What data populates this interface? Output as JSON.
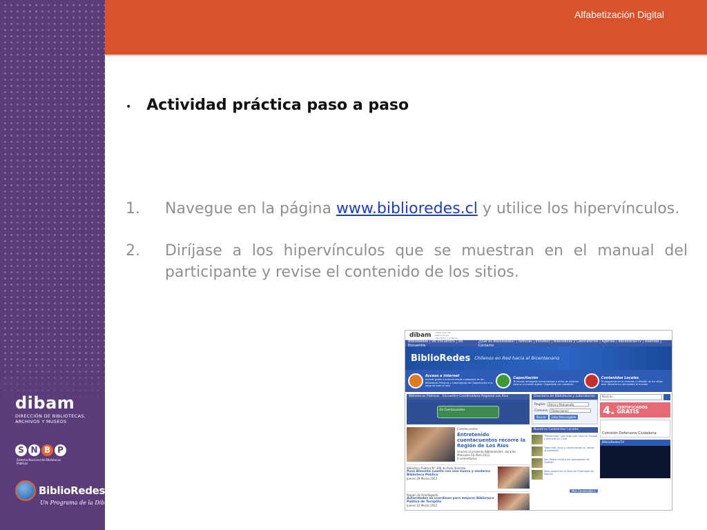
{
  "header": {
    "title": "Alfabetización Digital",
    "color": "#d9522a"
  },
  "sidebar": {
    "color": "#5b3c7a",
    "logos": {
      "dibam_word": "dibam",
      "dibam_sub_1": "DIRECCIÓN DE BIBLIOTECAS,",
      "dibam_sub_2": "ARCHIVOS Y MUSEOS",
      "snbp_letters": [
        "S",
        "N",
        "B",
        "P"
      ],
      "snbp_sub": "Sistema Nacional de Bibliotecas Públicas",
      "biblioredes_name": "BiblioRedes",
      "biblioredes_tag": "Un Programa de la Dibam"
    }
  },
  "content": {
    "bullet": "•",
    "heading": "Actividad práctica paso a paso",
    "steps": [
      {
        "number": "1.",
        "text_before": "Navegue en la página",
        "link": "www.biblioredes.cl",
        "text_after": "y utilice los hipervínculos."
      },
      {
        "number": "2.",
        "text": "Diríjase a los hipervínculos que se muestran en el manual del participante y revise el contenido de los sitios."
      }
    ]
  },
  "website": {
    "top_brand": "dibam",
    "top_sub": "DIRECCIÓN DE BIBLIOTECAS, ARCHIVOS Y MUSEOS",
    "nav_left": "BiblioRedes | VB Encuentro | VB Encuentro",
    "nav_right": "¿Qué es BiblioRedes? | Noticias | Estudios | Bibliotecas y Laboratorios | Agenda | BibliotecasTV | Alianzas | Contacto",
    "brand": "BiblioRedes",
    "slogan": "Chilenos en Red hacia el Bicentenario",
    "services": [
      {
        "title": "Acceso a Internet",
        "desc": "Accede gratis a internet desde cualquiera de las Bibliotecas Públicas y Laboratorios de Capacitación a lo largo de todo el país."
      },
      {
        "title": "Capacitación",
        "desc": "Te hemos entregado herramientas a miles de chilenos para su inclusión digital. Capacítate con nosotros."
      },
      {
        "title": "Contenidos Locales",
        "desc": "Te apoyamos en la creación y difusión de tus sitios web. Muestra tu comunidad al mundo!"
      }
    ],
    "radio_label": "Bibliotecas Públicas",
    "radio_station": "Encuentro Coordinadora Regional Los Ríos",
    "player_text": "En Cuentacuentos",
    "news_kicker": "Cuentacuentos",
    "news_title": "Entretenido cuentacuentos recorre la Región de Los Ríos",
    "news_desc": "Gracias al proyecto Bibliomóviles, durante",
    "news_date": "Miércoles 04 Abril 2012",
    "news_comments": "0 comentarios",
    "news2_kicker": "Biblioteca Pública N° 306 de Pozo Almonte",
    "news2_title": "Pozo Almonte cuenta con una nueva y moderno Biblioteca Pública",
    "news2_date": "Jueves 29 Marzo 2012",
    "news3_kicker": "Región de Antofagasta",
    "news3_title": "Autoridades se coordinan para mejorar Biblioteca Pública de Tocopilla",
    "news3_date": "Jueves 22 Marzo 2012",
    "directory_head": "Directorio de Bibliotecas y Laboratorios",
    "region_label": "Región:",
    "region_value": "Arica y Parinacota",
    "comuna_label": "Comuna:",
    "comuna_value": "[Seleccione]",
    "search_btn": "Buscar",
    "download_btn": "Lista Descargable",
    "local_head": "Nuestros Contenidos Locales",
    "local_items": [
      "\"Presencias\" una expo que nace en Europa y termina en Chile",
      "Toda miel, saco y conservando su raíces ancestrales",
      "San Pedro cuida a los pescadores de Queilén",
      "Sólo calidad en la Feria de Productos de Maullín"
    ],
    "more_btn": "Más Contenidos L",
    "search_placeholder": "Buscar...",
    "cert_number": "4.",
    "cert_line1": "CERTIFICADOS",
    "cert_line2": "GRATIS",
    "defensoria": "Comisión Defensora Ciudadana",
    "tv_label": "BiblioRedesTV"
  }
}
